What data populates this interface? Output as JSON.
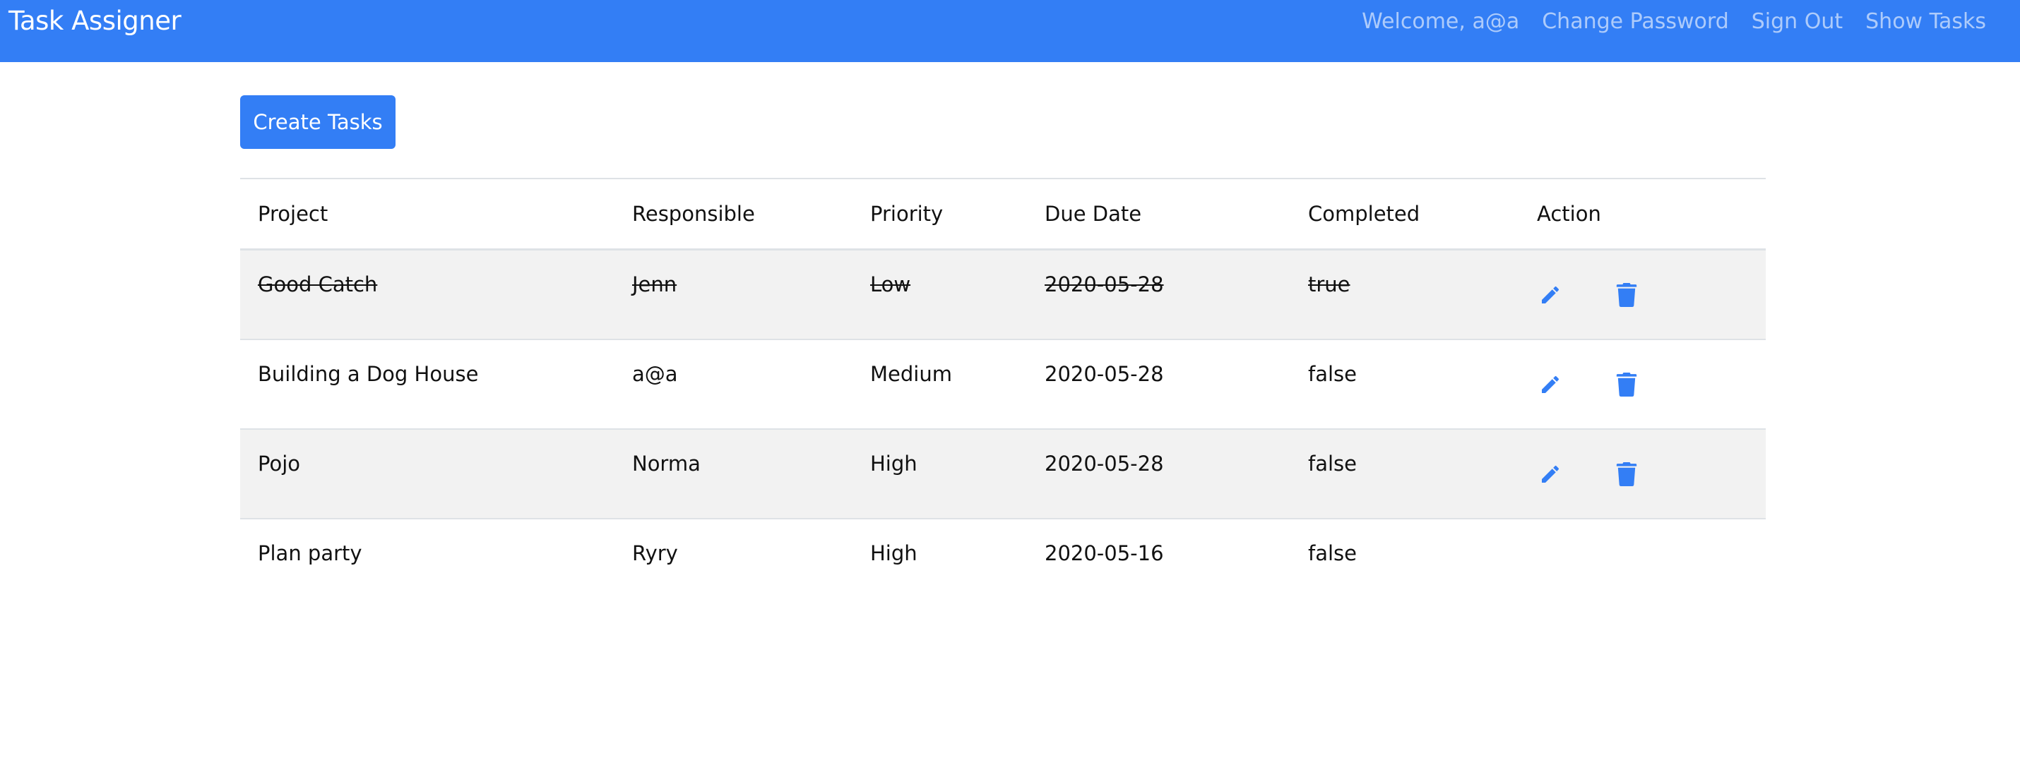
{
  "app": {
    "brand": "Task Assigner"
  },
  "nav": {
    "welcome": "Welcome, a@a",
    "change_password": "Change Password",
    "sign_out": "Sign Out",
    "show_tasks": "Show Tasks"
  },
  "toolbar": {
    "create_label": "Create Tasks"
  },
  "table": {
    "headers": [
      "Project",
      "Responsible",
      "Priority",
      "Due Date",
      "Completed",
      "Action"
    ],
    "rows": [
      {
        "project": "Good Catch",
        "responsible": "Jenn",
        "priority": "Low",
        "due_date": "2020-05-28",
        "completed": "true",
        "has_actions": true
      },
      {
        "project": "Building a Dog House",
        "responsible": "a@a",
        "priority": "Medium",
        "due_date": "2020-05-28",
        "completed": "false",
        "has_actions": true
      },
      {
        "project": "Pojo",
        "responsible": "Norma",
        "priority": "High",
        "due_date": "2020-05-28",
        "completed": "false",
        "has_actions": true
      },
      {
        "project": "Plan party",
        "responsible": "Ryry",
        "priority": "High",
        "due_date": "2020-05-16",
        "completed": "false",
        "has_actions": false
      }
    ],
    "icons": {
      "edit": "pencil-icon",
      "delete": "trash-icon"
    }
  },
  "colors": {
    "accent": "#337ef5",
    "stripe": "#f2f2f2",
    "border": "#dee2e6"
  }
}
